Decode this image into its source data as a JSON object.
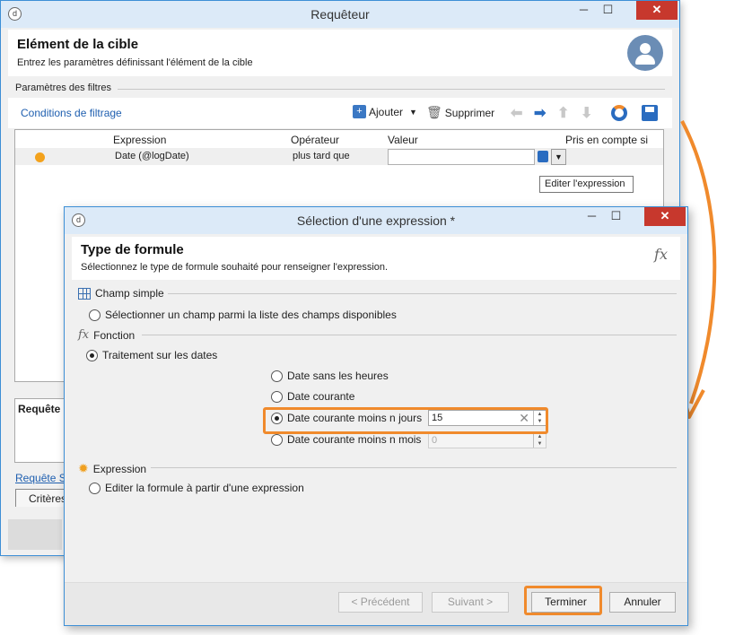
{
  "main_window": {
    "title": "Requêteur",
    "app_icon_text": "d",
    "header_title": "Elément de la cible",
    "header_subtitle": "Entrez les paramètres définissant l'élément de la cible",
    "filters_group": "Paramètres des filtres",
    "conditions_link": "Conditions de filtrage",
    "toolbar": {
      "add_label": "Ajouter",
      "delete_label": "Supprimer"
    },
    "grid": {
      "columns": [
        "Expression",
        "Opérateur",
        "Valeur",
        "Pris en compte si"
      ],
      "rows": [
        {
          "expression": "Date (@logDate)",
          "operator": "plus tard que",
          "value": ""
        }
      ]
    },
    "tooltip": "Editer l'expression",
    "query_label": "Requête :",
    "sql_link": "Requête SQ",
    "criteria_tab": "Critères"
  },
  "dialog": {
    "title": "Sélection d'une expression *",
    "app_icon_text": "d",
    "header_title": "Type de formule",
    "header_subtitle": "Sélectionnez le type de formule souhaité pour renseigner l'expression.",
    "section_simple": "Champ simple",
    "opt_simple": "Sélectionner un champ parmi la liste des champs disponibles",
    "section_function": "Fonction",
    "opt_dates": "Traitement sur les dates",
    "date_options": {
      "no_hours": "Date sans les heures",
      "current": "Date courante",
      "current_minus_days": "Date courante moins n jours",
      "current_minus_months": "Date courante moins n mois"
    },
    "days_value": "15",
    "months_value": "0",
    "section_expression": "Expression",
    "opt_expression": "Editer la formule à partir d'une expression",
    "buttons": {
      "previous": "< Précédent",
      "next": "Suivant >",
      "finish": "Terminer",
      "cancel": "Annuler"
    }
  },
  "colors": {
    "accent_orange": "#f08a2c",
    "link_blue": "#2060b0",
    "close_red": "#c7382d",
    "title_bg": "#dceaf8"
  }
}
